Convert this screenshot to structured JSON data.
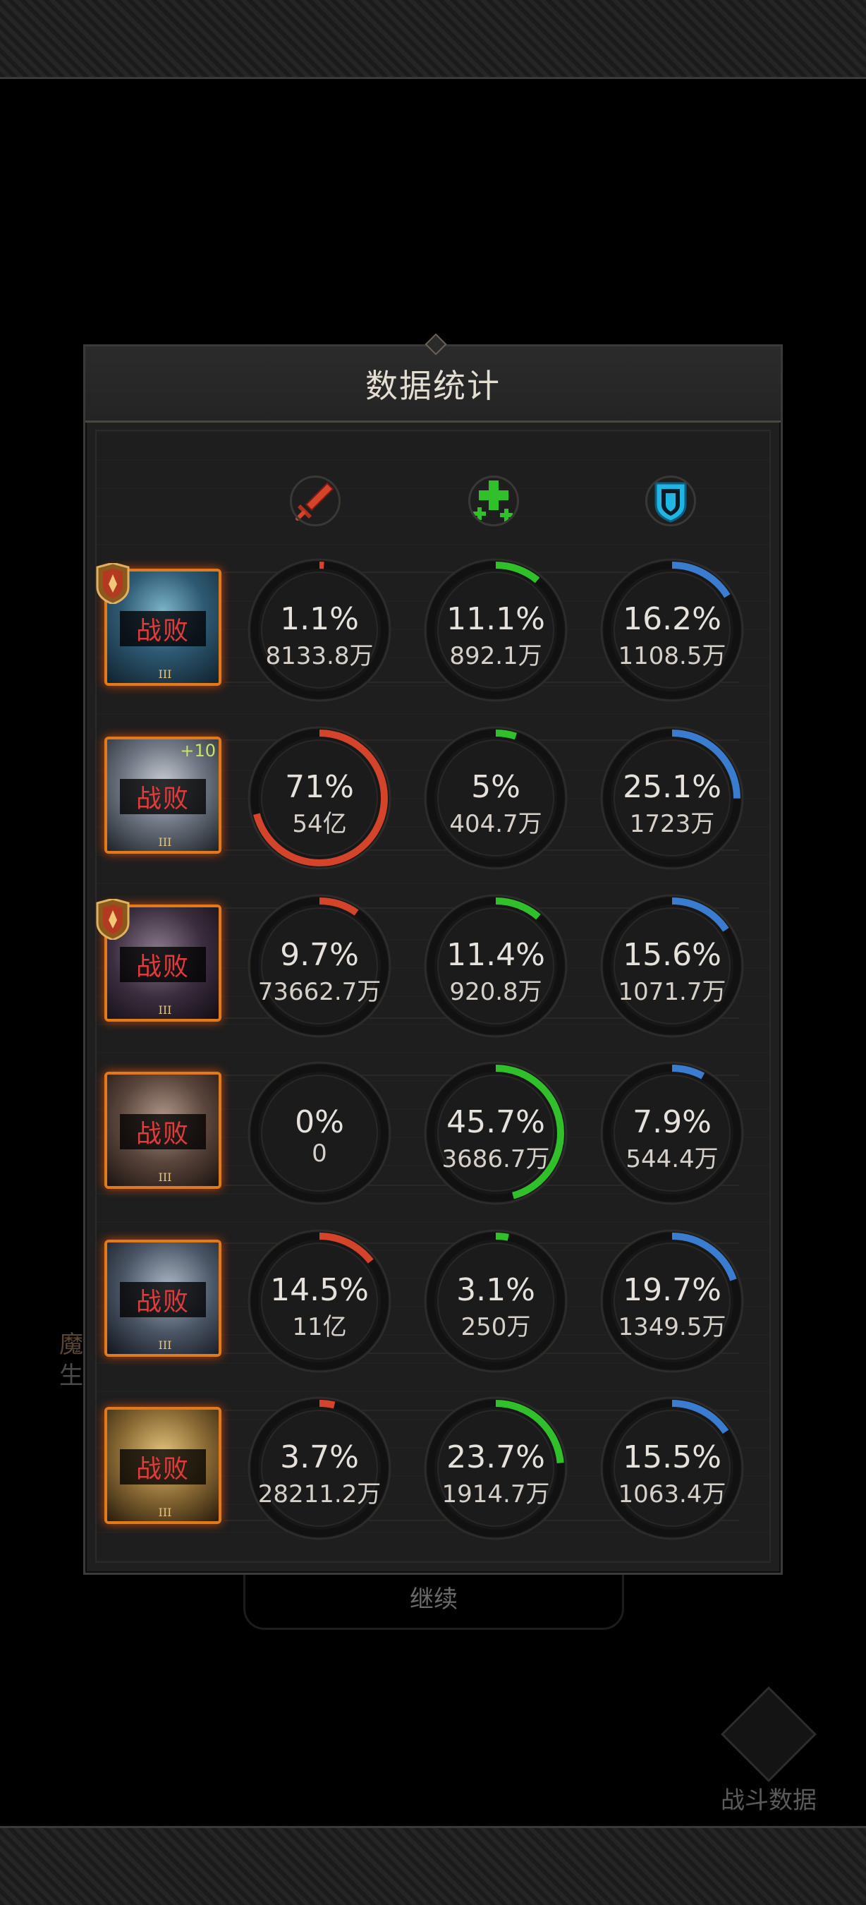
{
  "dialog": {
    "title": "数据统计"
  },
  "columns": [
    {
      "name": "damage",
      "icon": "red-sword-icon",
      "color": "#d4442a"
    },
    {
      "name": "healing",
      "icon": "green-cross-icon",
      "color": "#2fc02a"
    },
    {
      "name": "defense",
      "icon": "blue-shield-icon",
      "color": "#3a7ccf"
    }
  ],
  "heroes": [
    {
      "status": "战败",
      "tier": "III",
      "badge": true,
      "plus": "",
      "stats": [
        {
          "pct": "1.1%",
          "val": "8133.8万",
          "fraction": 0.011
        },
        {
          "pct": "11.1%",
          "val": "892.1万",
          "fraction": 0.111
        },
        {
          "pct": "16.2%",
          "val": "1108.5万",
          "fraction": 0.162
        }
      ]
    },
    {
      "status": "战败",
      "tier": "III",
      "badge": false,
      "plus": "+10",
      "stats": [
        {
          "pct": "71%",
          "val": "54亿",
          "fraction": 0.71
        },
        {
          "pct": "5%",
          "val": "404.7万",
          "fraction": 0.05
        },
        {
          "pct": "25.1%",
          "val": "1723万",
          "fraction": 0.251
        }
      ]
    },
    {
      "status": "战败",
      "tier": "III",
      "badge": true,
      "plus": "",
      "stats": [
        {
          "pct": "9.7%",
          "val": "73662.7万",
          "fraction": 0.097
        },
        {
          "pct": "11.4%",
          "val": "920.8万",
          "fraction": 0.114
        },
        {
          "pct": "15.6%",
          "val": "1071.7万",
          "fraction": 0.156
        }
      ]
    },
    {
      "status": "战败",
      "tier": "III",
      "badge": false,
      "plus": "",
      "stats": [
        {
          "pct": "0%",
          "val": "0",
          "fraction": 0
        },
        {
          "pct": "45.7%",
          "val": "3686.7万",
          "fraction": 0.457
        },
        {
          "pct": "7.9%",
          "val": "544.4万",
          "fraction": 0.079
        }
      ]
    },
    {
      "status": "战败",
      "tier": "III",
      "badge": false,
      "plus": "",
      "stats": [
        {
          "pct": "14.5%",
          "val": "11亿",
          "fraction": 0.145
        },
        {
          "pct": "3.1%",
          "val": "250万",
          "fraction": 0.031
        },
        {
          "pct": "19.7%",
          "val": "1349.5万",
          "fraction": 0.197
        }
      ]
    },
    {
      "status": "战败",
      "tier": "III",
      "badge": false,
      "plus": "",
      "stats": [
        {
          "pct": "3.7%",
          "val": "28211.2万",
          "fraction": 0.037
        },
        {
          "pct": "23.7%",
          "val": "1914.7万",
          "fraction": 0.237
        },
        {
          "pct": "15.5%",
          "val": "1063.4万",
          "fraction": 0.155
        }
      ]
    }
  ],
  "background": {
    "continue_label": "继续",
    "battle_data_label": "战斗数据",
    "side_text_1": "魔",
    "side_text_2": "生"
  }
}
